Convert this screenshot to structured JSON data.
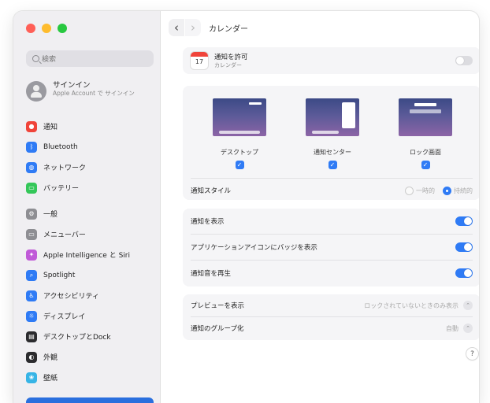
{
  "sidebar": {
    "search_placeholder": "検索",
    "account": {
      "title": "サインイン",
      "subtitle": "Apple Account で サインイン"
    },
    "items": [
      {
        "label": "通知",
        "icon": "bell-icon",
        "color": "#f0443a"
      },
      {
        "label": "Bluetooth",
        "icon": "bluetooth-icon",
        "color": "#2f7bf5"
      },
      {
        "label": "ネットワーク",
        "icon": "globe-icon",
        "color": "#2f7bf5"
      },
      {
        "label": "バッテリー",
        "icon": "battery-icon",
        "color": "#34c759"
      },
      {
        "label": "一般",
        "icon": "gear-icon",
        "color": "#8e8e93"
      },
      {
        "label": "メニューバー",
        "icon": "menubar-icon",
        "color": "#8e8e93"
      },
      {
        "label": "Apple Intelligence と Siri",
        "icon": "siri-icon",
        "color": "#c05ad8"
      },
      {
        "label": "Spotlight",
        "icon": "spotlight-icon",
        "color": "#2f7bf5"
      },
      {
        "label": "アクセシビリティ",
        "icon": "accessibility-icon",
        "color": "#2f7bf5"
      },
      {
        "label": "ディスプレイ",
        "icon": "display-icon",
        "color": "#2f7bf5"
      },
      {
        "label": "デスクトップとDock",
        "icon": "dock-icon",
        "color": "#2b2b2e"
      },
      {
        "label": "外観",
        "icon": "appearance-icon",
        "color": "#2b2b2e"
      },
      {
        "label": "壁紙",
        "icon": "wallpaper-icon",
        "color": "#37b4e6"
      }
    ]
  },
  "header": {
    "title": "カレンダー",
    "back_symbol": "‹",
    "forward_symbol": "›"
  },
  "app_row": {
    "title": "通知を許可",
    "subtitle": "カレンダー",
    "icon": "calendar-icon",
    "icon_day": "17",
    "allow_enabled": false
  },
  "styles": {
    "options": [
      {
        "label": "デスクトップ",
        "checked": true
      },
      {
        "label": "通知センター",
        "checked": true
      },
      {
        "label": "ロック画面",
        "checked": true
      }
    ],
    "alert_row": {
      "label": "通知スタイル",
      "options": [
        "一時的",
        "持続的"
      ],
      "selected": "持続的"
    }
  },
  "toggles": [
    {
      "label": "通知を表示",
      "on": true
    },
    {
      "label": "アプリケーションアイコンにバッジを表示",
      "on": true
    },
    {
      "label": "通知音を再生",
      "on": true
    }
  ],
  "selects": [
    {
      "label": "プレビューを表示",
      "value": "ロックされていないときのみ表示"
    },
    {
      "label": "通知のグループ化",
      "value": "自動"
    }
  ],
  "help_label": "?",
  "check_glyph": "✓",
  "stepper_glyph": "⌃"
}
